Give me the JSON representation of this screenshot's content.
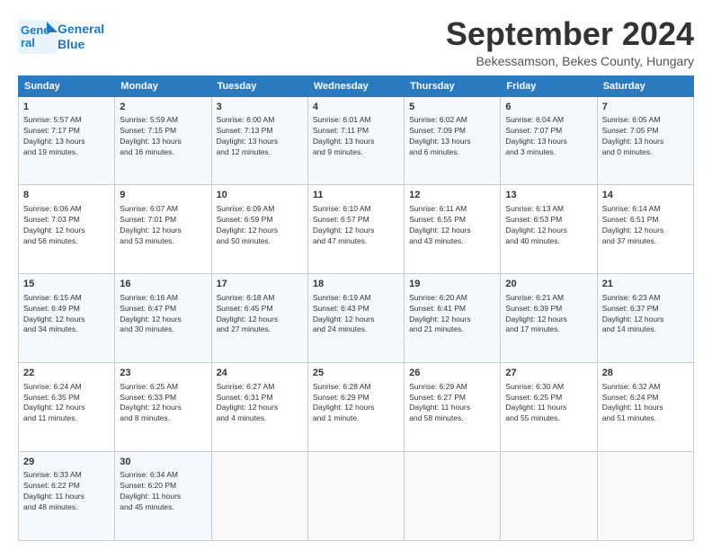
{
  "header": {
    "logo_line1": "General",
    "logo_line2": "Blue",
    "month_title": "September 2024",
    "location": "Bekessamson, Bekes County, Hungary"
  },
  "columns": [
    "Sunday",
    "Monday",
    "Tuesday",
    "Wednesday",
    "Thursday",
    "Friday",
    "Saturday"
  ],
  "weeks": [
    [
      {
        "day": "1",
        "info": "Sunrise: 5:57 AM\nSunset: 7:17 PM\nDaylight: 13 hours\nand 19 minutes."
      },
      {
        "day": "2",
        "info": "Sunrise: 5:59 AM\nSunset: 7:15 PM\nDaylight: 13 hours\nand 16 minutes."
      },
      {
        "day": "3",
        "info": "Sunrise: 6:00 AM\nSunset: 7:13 PM\nDaylight: 13 hours\nand 12 minutes."
      },
      {
        "day": "4",
        "info": "Sunrise: 6:01 AM\nSunset: 7:11 PM\nDaylight: 13 hours\nand 9 minutes."
      },
      {
        "day": "5",
        "info": "Sunrise: 6:02 AM\nSunset: 7:09 PM\nDaylight: 13 hours\nand 6 minutes."
      },
      {
        "day": "6",
        "info": "Sunrise: 6:04 AM\nSunset: 7:07 PM\nDaylight: 13 hours\nand 3 minutes."
      },
      {
        "day": "7",
        "info": "Sunrise: 6:05 AM\nSunset: 7:05 PM\nDaylight: 13 hours\nand 0 minutes."
      }
    ],
    [
      {
        "day": "8",
        "info": "Sunrise: 6:06 AM\nSunset: 7:03 PM\nDaylight: 12 hours\nand 56 minutes."
      },
      {
        "day": "9",
        "info": "Sunrise: 6:07 AM\nSunset: 7:01 PM\nDaylight: 12 hours\nand 53 minutes."
      },
      {
        "day": "10",
        "info": "Sunrise: 6:09 AM\nSunset: 6:59 PM\nDaylight: 12 hours\nand 50 minutes."
      },
      {
        "day": "11",
        "info": "Sunrise: 6:10 AM\nSunset: 6:57 PM\nDaylight: 12 hours\nand 47 minutes."
      },
      {
        "day": "12",
        "info": "Sunrise: 6:11 AM\nSunset: 6:55 PM\nDaylight: 12 hours\nand 43 minutes."
      },
      {
        "day": "13",
        "info": "Sunrise: 6:13 AM\nSunset: 6:53 PM\nDaylight: 12 hours\nand 40 minutes."
      },
      {
        "day": "14",
        "info": "Sunrise: 6:14 AM\nSunset: 6:51 PM\nDaylight: 12 hours\nand 37 minutes."
      }
    ],
    [
      {
        "day": "15",
        "info": "Sunrise: 6:15 AM\nSunset: 6:49 PM\nDaylight: 12 hours\nand 34 minutes."
      },
      {
        "day": "16",
        "info": "Sunrise: 6:16 AM\nSunset: 6:47 PM\nDaylight: 12 hours\nand 30 minutes."
      },
      {
        "day": "17",
        "info": "Sunrise: 6:18 AM\nSunset: 6:45 PM\nDaylight: 12 hours\nand 27 minutes."
      },
      {
        "day": "18",
        "info": "Sunrise: 6:19 AM\nSunset: 6:43 PM\nDaylight: 12 hours\nand 24 minutes."
      },
      {
        "day": "19",
        "info": "Sunrise: 6:20 AM\nSunset: 6:41 PM\nDaylight: 12 hours\nand 21 minutes."
      },
      {
        "day": "20",
        "info": "Sunrise: 6:21 AM\nSunset: 6:39 PM\nDaylight: 12 hours\nand 17 minutes."
      },
      {
        "day": "21",
        "info": "Sunrise: 6:23 AM\nSunset: 6:37 PM\nDaylight: 12 hours\nand 14 minutes."
      }
    ],
    [
      {
        "day": "22",
        "info": "Sunrise: 6:24 AM\nSunset: 6:35 PM\nDaylight: 12 hours\nand 11 minutes."
      },
      {
        "day": "23",
        "info": "Sunrise: 6:25 AM\nSunset: 6:33 PM\nDaylight: 12 hours\nand 8 minutes."
      },
      {
        "day": "24",
        "info": "Sunrise: 6:27 AM\nSunset: 6:31 PM\nDaylight: 12 hours\nand 4 minutes."
      },
      {
        "day": "25",
        "info": "Sunrise: 6:28 AM\nSunset: 6:29 PM\nDaylight: 12 hours\nand 1 minute."
      },
      {
        "day": "26",
        "info": "Sunrise: 6:29 AM\nSunset: 6:27 PM\nDaylight: 11 hours\nand 58 minutes."
      },
      {
        "day": "27",
        "info": "Sunrise: 6:30 AM\nSunset: 6:25 PM\nDaylight: 11 hours\nand 55 minutes."
      },
      {
        "day": "28",
        "info": "Sunrise: 6:32 AM\nSunset: 6:24 PM\nDaylight: 11 hours\nand 51 minutes."
      }
    ],
    [
      {
        "day": "29",
        "info": "Sunrise: 6:33 AM\nSunset: 6:22 PM\nDaylight: 11 hours\nand 48 minutes."
      },
      {
        "day": "30",
        "info": "Sunrise: 6:34 AM\nSunset: 6:20 PM\nDaylight: 11 hours\nand 45 minutes."
      },
      {
        "day": "",
        "info": ""
      },
      {
        "day": "",
        "info": ""
      },
      {
        "day": "",
        "info": ""
      },
      {
        "day": "",
        "info": ""
      },
      {
        "day": "",
        "info": ""
      }
    ]
  ]
}
